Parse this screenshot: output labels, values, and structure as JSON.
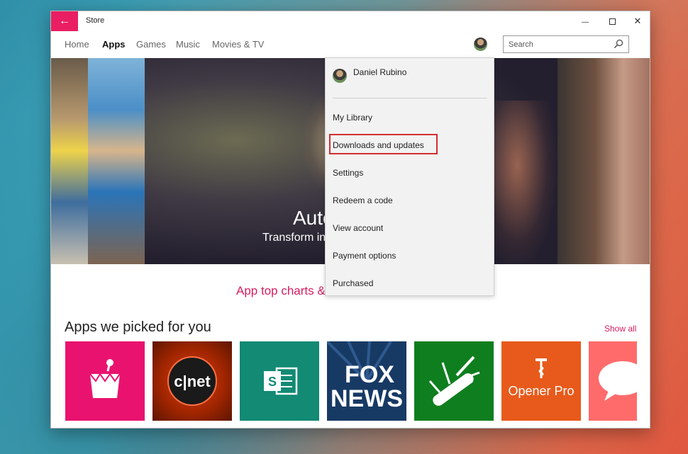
{
  "window": {
    "title": "Store",
    "back_icon": "←",
    "controls": {
      "minimize": "—",
      "close": "✕"
    }
  },
  "nav": {
    "items": [
      "Home",
      "Apps",
      "Games",
      "Music",
      "Movies & TV"
    ],
    "active": "Apps",
    "search": {
      "placeholder": "Search",
      "value": ""
    }
  },
  "hero": {
    "title": "Auto",
    "subtitle": "Transform in"
  },
  "charts_link": "App top charts & ",
  "section": {
    "title": "Apps we picked for you",
    "show_all": "Show all",
    "apps": [
      {
        "icon": "reddit-alien-icon",
        "color": "#e9136f"
      },
      {
        "icon": "cnet-logo-icon",
        "color": "#b32a00",
        "logo_text": "c|net"
      },
      {
        "icon": "sway-icon",
        "color": "#128a74"
      },
      {
        "icon": "fox-news-logo-icon",
        "color": "#173a64",
        "logo_text": "FOX NEWS"
      },
      {
        "icon": "swiss-knife-icon",
        "color": "#0f7e1e"
      },
      {
        "icon": "corkscrew-icon",
        "color": "#e85a1b",
        "logo_text": "Opener Pro"
      },
      {
        "icon": "speech-bubble-icon",
        "color": "#ff6b6b"
      }
    ]
  },
  "account_menu": {
    "user_name": "Daniel Rubino",
    "items": [
      "My Library",
      "Downloads and updates",
      "Settings",
      "Redeem a code",
      "View account",
      "Payment options",
      "Purchased"
    ],
    "highlighted": "Downloads and updates",
    "highlight_color": "#d32f2f"
  },
  "colors": {
    "accent": "#e91e63",
    "link": "#d81b60"
  }
}
